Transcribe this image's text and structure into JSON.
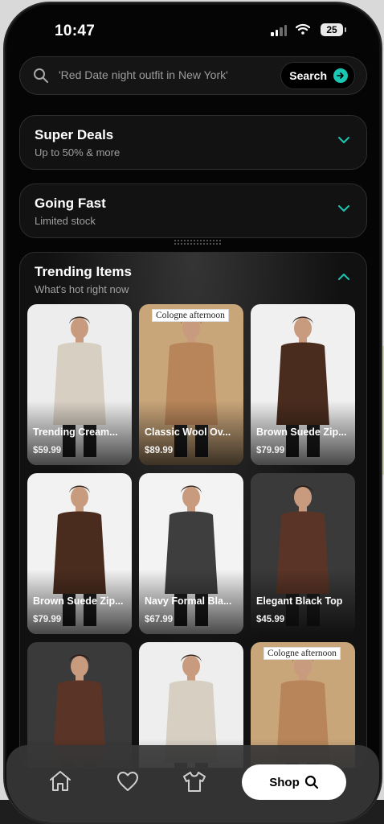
{
  "status_bar": {
    "time": "10:47",
    "battery": "25"
  },
  "search": {
    "placeholder": "'Red Date night outfit in New York'",
    "button_label": "Search"
  },
  "sections": [
    {
      "title": "Super Deals",
      "subtitle": "Up to 50% & more",
      "expanded": false
    },
    {
      "title": "Going Fast",
      "subtitle": "Limited stock",
      "expanded": false
    },
    {
      "title": "Trending Items",
      "subtitle": "What's hot right now",
      "expanded": true
    }
  ],
  "products": [
    {
      "name": "Trending Cream...",
      "price": "$59.99",
      "badge": "",
      "image": "cream-coat-woman",
      "bg": "#ededed",
      "garment": "#d8cfc3"
    },
    {
      "name": "Classic Wool Ov...",
      "price": "$89.99",
      "badge": "Cologne afternoon",
      "image": "camel-coat-woman-mall",
      "bg": "#c9a57a",
      "garment": "#b78559"
    },
    {
      "name": "Brown Suede Zip...",
      "price": "$79.99",
      "badge": "",
      "image": "brown-suede-jacket-man",
      "bg": "#f0f0f0",
      "garment": "#4a2c1e"
    },
    {
      "name": "Brown Suede Zip...",
      "price": "$79.99",
      "badge": "",
      "image": "brown-suede-jacket-man",
      "bg": "#f2f2f2",
      "garment": "#4a2c1e"
    },
    {
      "name": "Navy Formal Bla...",
      "price": "$67.99",
      "badge": "",
      "image": "gray-wool-coat-man",
      "bg": "#f3f3f3",
      "garment": "#3e3e3e"
    },
    {
      "name": "Elegant Black Top",
      "price": "$45.99",
      "badge": "",
      "image": "brown-knit-set-woman",
      "bg": "#3a3a3a",
      "garment": "#5a3426"
    },
    {
      "name": "",
      "price": "",
      "badge": "",
      "image": "brown-knit-set-woman",
      "bg": "#3a3a3a",
      "garment": "#5a3426"
    },
    {
      "name": "",
      "price": "",
      "badge": "",
      "image": "cream-coat-woman",
      "bg": "#eeeeee",
      "garment": "#d8cfc3"
    },
    {
      "name": "",
      "price": "",
      "badge": "Cologne afternoon",
      "image": "camel-coat-woman-mall",
      "bg": "#c9a57a",
      "garment": "#b78559"
    }
  ],
  "bottom_nav": {
    "items": [
      {
        "icon": "home-icon"
      },
      {
        "icon": "heart-icon"
      },
      {
        "icon": "shirt-icon"
      }
    ],
    "shop_label": "Shop"
  },
  "colors": {
    "accent": "#1ac7b3",
    "background": "#050505",
    "card": "#121212"
  }
}
